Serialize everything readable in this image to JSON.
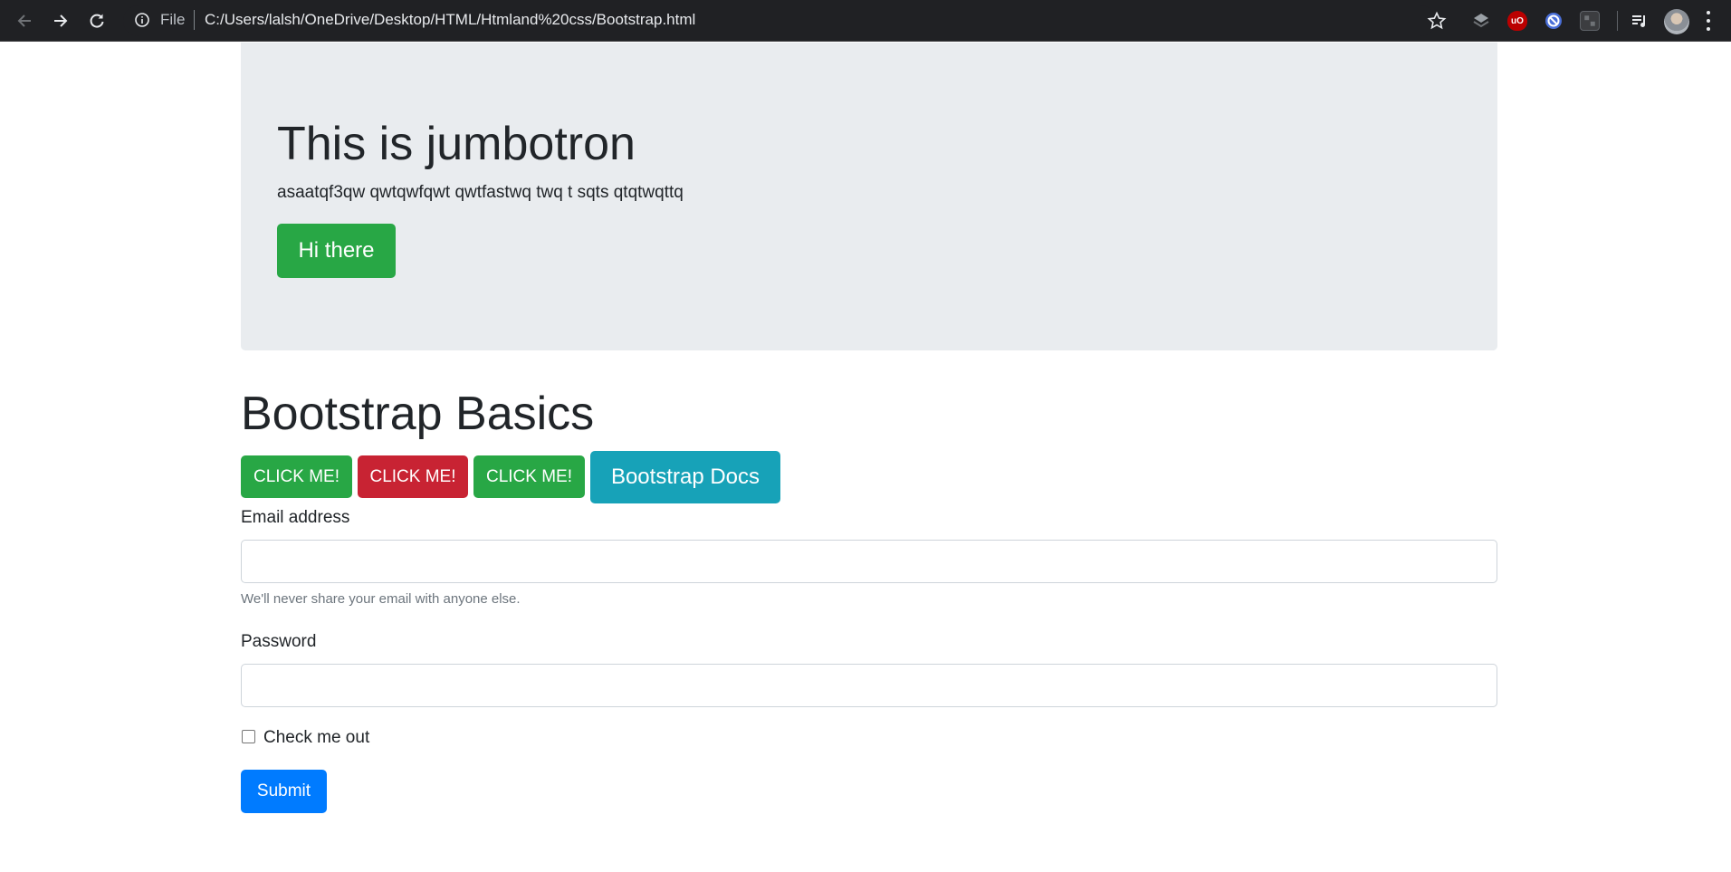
{
  "browser": {
    "file_label": "File",
    "url": "C:/Users/lalsh/OneDrive/Desktop/HTML/Htmland%20css/Bootstrap.html",
    "icons": [
      "back-icon",
      "forward-icon",
      "reload-icon",
      "info-icon",
      "star-icon",
      "layers-extension-icon",
      "ublock-extension-icon",
      "block-extension-icon",
      "grid-extension-icon",
      "media-control-icon",
      "profile-avatar",
      "menu-icon"
    ]
  },
  "jumbotron": {
    "title": "This is jumbotron",
    "text": "asaatqf3qw qwtqwfqwt qwtfastwq twq t sqts qtqtwqttq",
    "button_label": "Hi there"
  },
  "basics": {
    "title": "Bootstrap Basics",
    "buttons": [
      {
        "label": "CLICK ME!",
        "color": "#28a745"
      },
      {
        "label": "CLICK ME!",
        "color": "#c82333"
      },
      {
        "label": "CLICK ME!",
        "color": "#28a745"
      },
      {
        "label": "Bootstrap Docs",
        "color": "#17a2b8"
      }
    ]
  },
  "form": {
    "email_label": "Email address",
    "email_value": "",
    "email_help": "We'll never share your email with anyone else.",
    "password_label": "Password",
    "password_value": "",
    "checkbox_label": "Check me out",
    "checkbox_checked": false,
    "submit_label": "Submit",
    "submit_color": "#007bff"
  }
}
